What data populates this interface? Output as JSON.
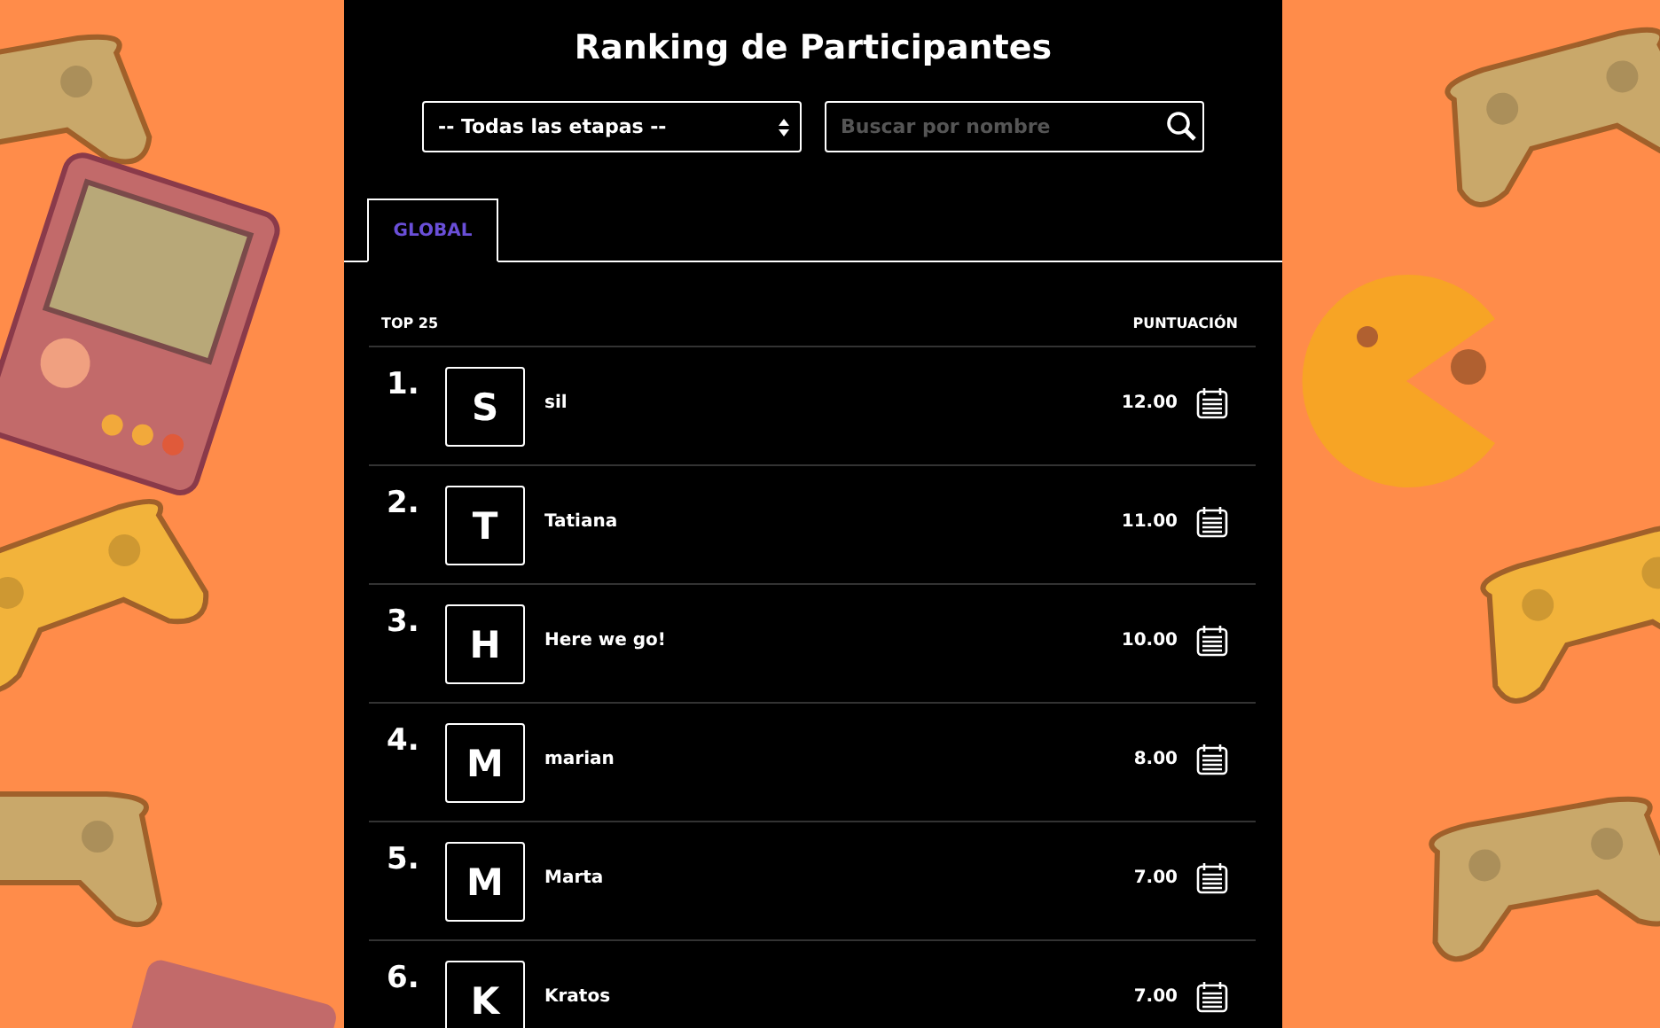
{
  "title": "Ranking de Participantes",
  "stage_select": {
    "value": "-- Todas las etapas --"
  },
  "search": {
    "placeholder": "Buscar por nombre"
  },
  "tabs": [
    {
      "label": "GLOBAL",
      "selected": true
    }
  ],
  "table": {
    "columns": [
      "TOP 25",
      "PUNTUACIÓN"
    ],
    "rows": [
      {
        "rank": "1.",
        "initial": "S",
        "name": "sil",
        "score": "12.00"
      },
      {
        "rank": "2.",
        "initial": "T",
        "name": "Tatiana",
        "score": "11.00"
      },
      {
        "rank": "3.",
        "initial": "H",
        "name": "Here we go!",
        "score": "10.00"
      },
      {
        "rank": "4.",
        "initial": "M",
        "name": "marian",
        "score": "8.00"
      },
      {
        "rank": "5.",
        "initial": "M",
        "name": "Marta",
        "score": "7.00"
      },
      {
        "rank": "6.",
        "initial": "K",
        "name": "Kratos",
        "score": "7.00"
      }
    ]
  }
}
